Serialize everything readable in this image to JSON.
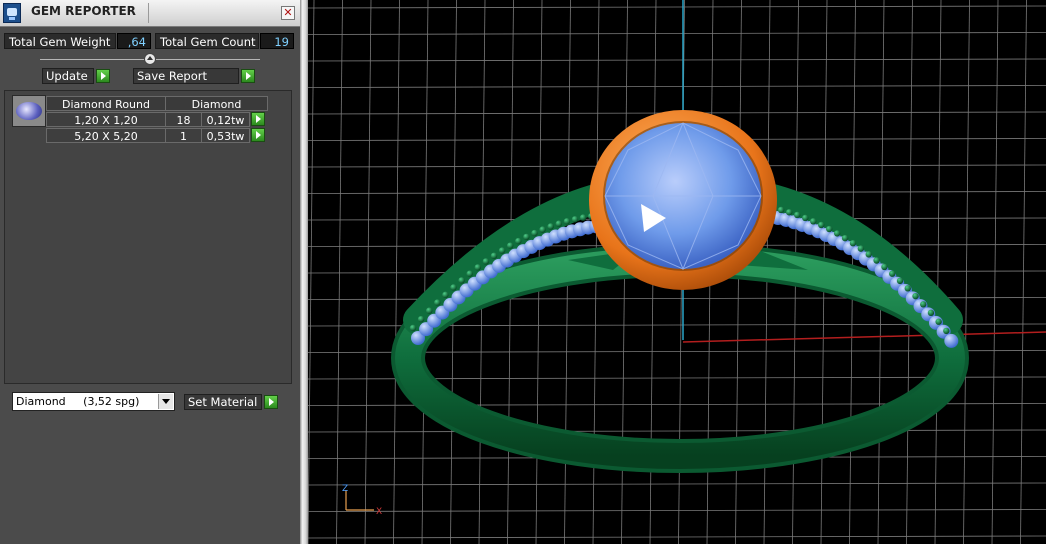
{
  "window": {
    "title": "GEM REPORTER",
    "close_glyph": "✕"
  },
  "summary": {
    "weight_label": "Total Gem Weight",
    "weight_value": ",64",
    "count_label": "Total Gem Count",
    "count_value": "19"
  },
  "actions": {
    "update_label": "Update",
    "save_label": "Save Report"
  },
  "table": {
    "headers": [
      "Diamond Round",
      "Diamond"
    ],
    "rows": [
      {
        "size": "1,20 X 1,20",
        "count": "18",
        "weight": "0,12tw"
      },
      {
        "size": "5,20 X 5,20",
        "count": "1",
        "weight": "0,53tw"
      }
    ]
  },
  "material": {
    "selected": "Diamond     (3,52 spg)",
    "set_label": "Set Material"
  },
  "axis_gizmo": {
    "z": "Z",
    "x": "X"
  },
  "colors": {
    "metal": "#0f6e3d",
    "bezel": "#e8741a",
    "gem": "#6f9bea",
    "grid": "#7a7a7a",
    "axis_blue": "#2aa6c8",
    "axis_red": "#b31e1e"
  },
  "icons": [
    "app-icon",
    "close-icon",
    "gem-thumbnail-icon",
    "play-arrow-icon",
    "dropdown-arrow-icon"
  ]
}
